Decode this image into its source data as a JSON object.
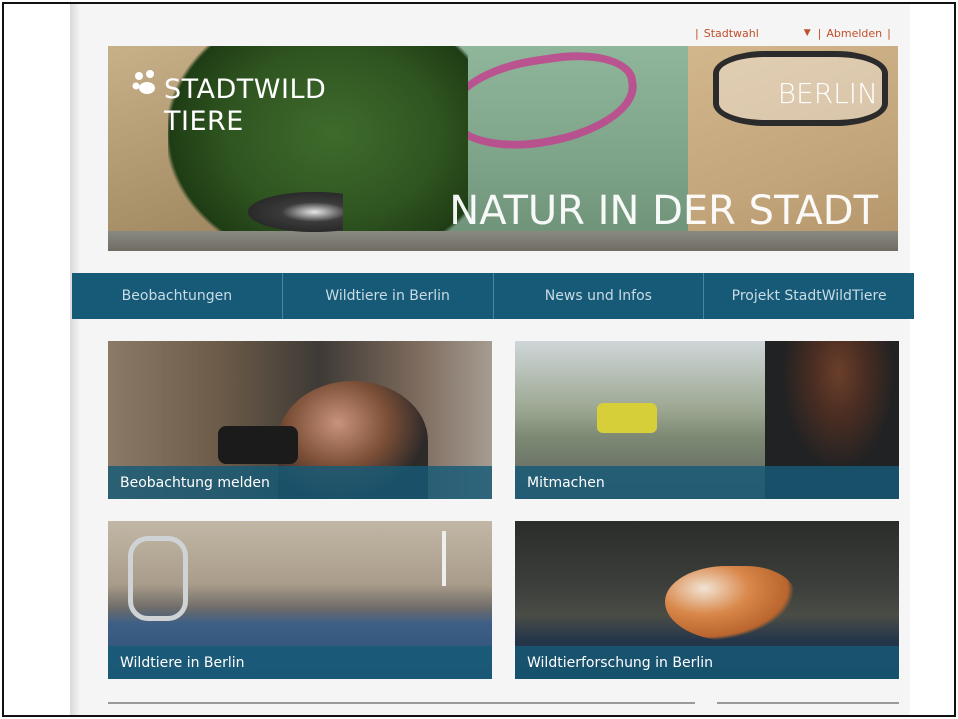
{
  "toplinks": {
    "city_select": "Stadtwahl",
    "logout": "Abmelden"
  },
  "hero": {
    "logo_line1": "STADTWILD",
    "logo_line2": "TIERE",
    "city": "BERLIN",
    "slogan": "NATUR IN DER STADT"
  },
  "nav": {
    "items": [
      {
        "label": "Beobachtungen"
      },
      {
        "label": "Wildtiere in Berlin"
      },
      {
        "label": "News und Infos"
      },
      {
        "label": "Projekt StadtWildTiere"
      }
    ]
  },
  "tiles": [
    {
      "label": "Beobachtung melden"
    },
    {
      "label": "Mitmachen"
    },
    {
      "label": "Wildtiere in Berlin"
    },
    {
      "label": "Wildtierforschung in Berlin"
    }
  ],
  "colors": {
    "nav_bg": "#165a78",
    "link_accent": "#c0502a"
  }
}
